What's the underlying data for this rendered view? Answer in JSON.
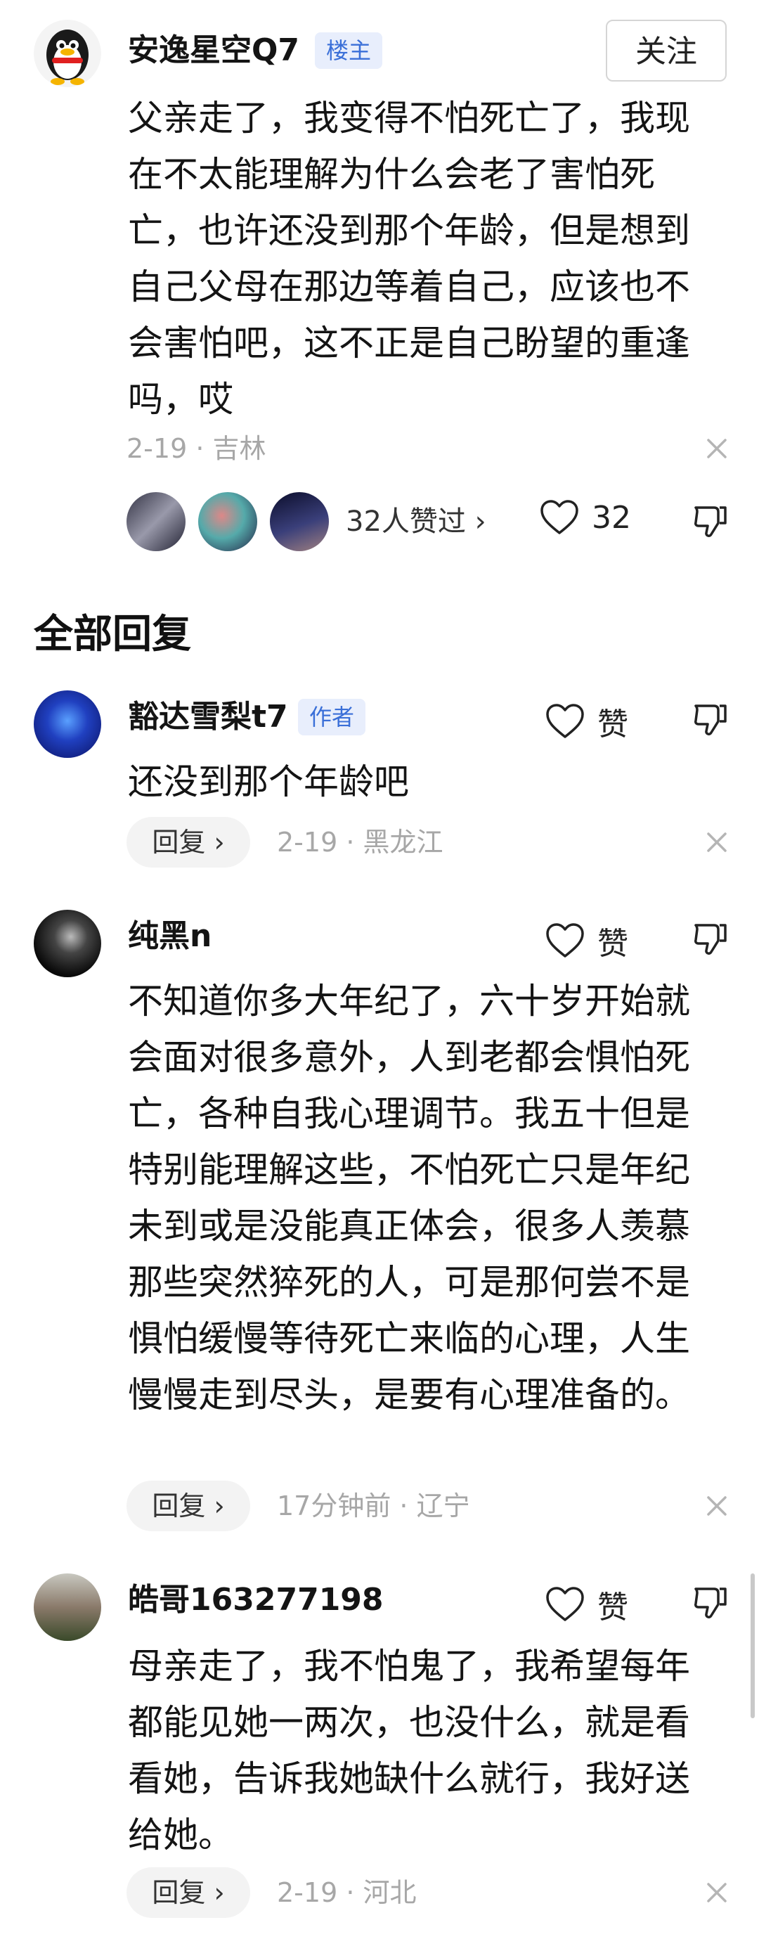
{
  "top_comment": {
    "user": "安逸星空Q7",
    "badge": "楼主",
    "follow_label": "关注",
    "text": "父亲走了，我变得不怕死亡了，我现在不太能理解为什么会老了害怕死亡，也许还没到那个年龄，但是想到自己父母在那边等着自己，应该也不会害怕吧，这不正是自己盼望的重逢吗，哎",
    "meta": "2-19 · 吉林",
    "likers_label": "32人赞过 ›",
    "like_count": "32"
  },
  "section_title": "全部回复",
  "replies": [
    {
      "user": "豁达雪梨t7",
      "badge": "作者",
      "like_label": "赞",
      "text": "还没到那个年龄吧",
      "reply_label": "回复 ›",
      "meta": "2-19 · 黑龙江"
    },
    {
      "user": "纯黑n",
      "like_label": "赞",
      "text": "不知道你多大年纪了，六十岁开始就会面对很多意外，人到老都会惧怕死亡，各种自我心理调节。我五十但是特别能理解这些，不怕死亡只是年纪未到或是没能真正体会，很多人羡慕那些突然猝死的人，可是那何尝不是惧怕缓慢等待死亡来临的心理，人生慢慢走到尽头，是要有心理准备的。",
      "reply_label": "回复 ›",
      "meta": "17分钟前 · 辽宁"
    },
    {
      "user": "皓哥163277198",
      "like_label": "赞",
      "text": "母亲走了，我不怕鬼了，我希望每年都能见她一两次，也没什么，就是看看她，告诉我她缺什么就行，我好送给她。",
      "reply_label": "回复 ›",
      "meta": "2-19 · 河北"
    }
  ],
  "colors": {
    "badge_bg": "#e8eefc",
    "badge_text": "#3a6fd8",
    "meta": "#a7a7a7"
  }
}
